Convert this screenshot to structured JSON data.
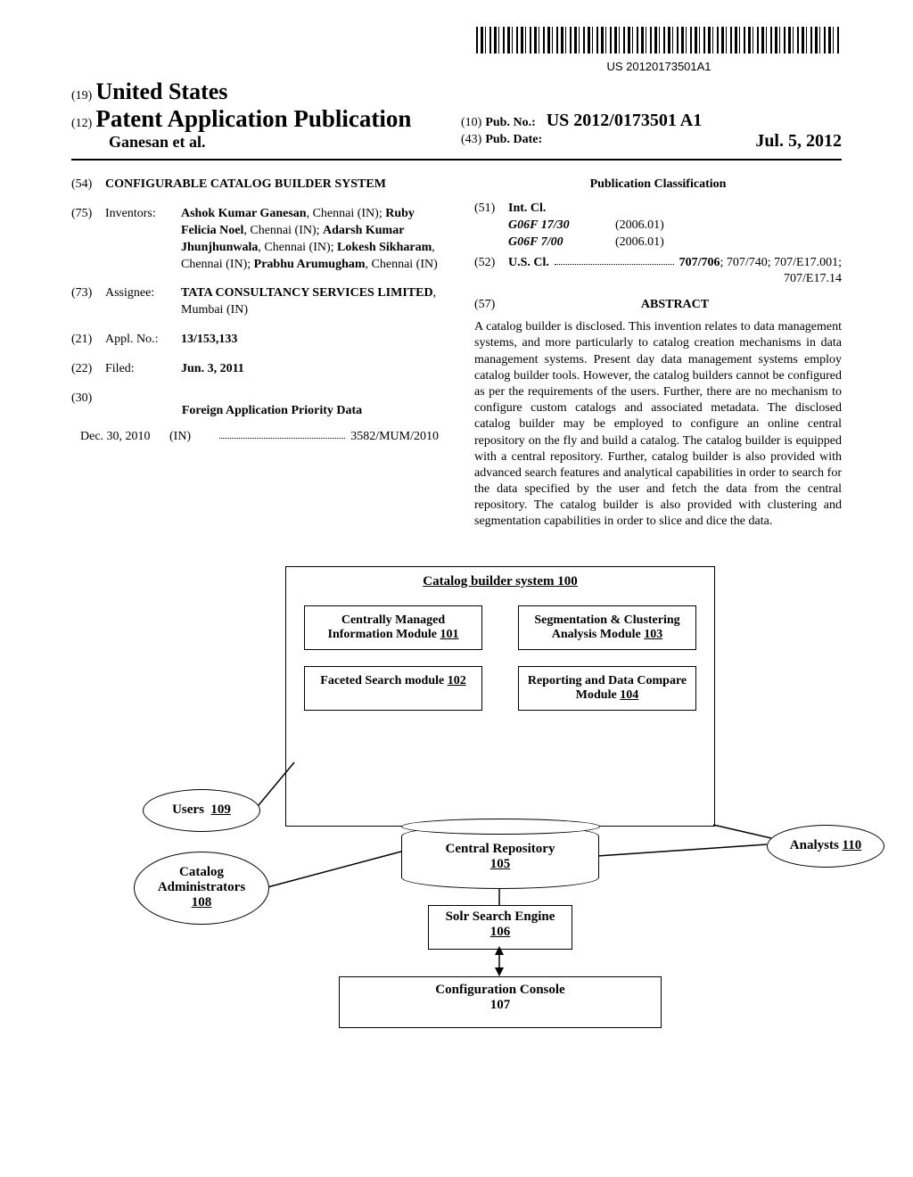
{
  "barcode_number": "US 20120173501A1",
  "header": {
    "code19": "(19)",
    "country": "United States",
    "code12": "(12)",
    "pub_type": "Patent Application Publication",
    "authors": "Ganesan et al.",
    "code10": "(10)",
    "pub_no_label": "Pub. No.:",
    "pub_no": "US 2012/0173501 A1",
    "code43": "(43)",
    "pub_date_label": "Pub. Date:",
    "pub_date": "Jul. 5, 2012"
  },
  "fields": {
    "title_code": "(54)",
    "title": "CONFIGURABLE CATALOG BUILDER SYSTEM",
    "inventors_code": "(75)",
    "inventors_label": "Inventors:",
    "inventors_value": "Ashok Kumar Ganesan, Chennai (IN); Ruby Felicia Noel, Chennai (IN); Adarsh Kumar Jhunjhunwala, Chennai (IN); Lokesh Sikharam, Chennai (IN); Prabhu Arumugham, Chennai (IN)",
    "assignee_code": "(73)",
    "assignee_label": "Assignee:",
    "assignee_value": "TATA CONSULTANCY SERVICES LIMITED, Mumbai (IN)",
    "appl_code": "(21)",
    "appl_label": "Appl. No.:",
    "appl_value": "13/153,133",
    "filed_code": "(22)",
    "filed_label": "Filed:",
    "filed_value": "Jun. 3, 2011",
    "foreign_code": "(30)",
    "foreign_head": "Foreign Application Priority Data",
    "foreign_date": "Dec. 30, 2010",
    "foreign_cc": "(IN)",
    "foreign_num": "3582/MUM/2010"
  },
  "classification": {
    "pub_class_head": "Publication Classification",
    "intcl_code": "(51)",
    "intcl_label": "Int. Cl.",
    "intcl_1_name": "G06F 17/30",
    "intcl_1_ver": "(2006.01)",
    "intcl_2_name": "G06F 7/00",
    "intcl_2_ver": "(2006.01)",
    "uscl_code": "(52)",
    "uscl_label": "U.S. Cl.",
    "uscl_value": "707/706; 707/740; 707/E17.001; 707/E17.14"
  },
  "abstract": {
    "code": "(57)",
    "head": "ABSTRACT",
    "body": "A catalog builder is disclosed. This invention relates to data management systems, and more particularly to catalog creation mechanisms in data management systems. Present day data management systems employ catalog builder tools. However, the catalog builders cannot be configured as per the requirements of the users. Further, there are no mechanism to configure custom catalogs and associated metadata. The disclosed catalog builder may be employed to configure an online central repository on the fly and build a catalog. The catalog builder is equipped with a central repository. Further, catalog builder is also provided with advanced search features and analytical capabilities in order to search for the data specified by the user and fetch the data from the central repository. The catalog builder is also provided with clustering and segmentation capabilities in order to slice and dice the data."
  },
  "figure": {
    "system_title": "Catalog builder system",
    "system_ref": "100",
    "mod1": "Centrally Managed Information Module",
    "mod1_ref": "101",
    "mod2": "Faceted Search module",
    "mod2_ref": "102",
    "mod3": "Segmentation & Clustering Analysis Module",
    "mod3_ref": "103",
    "mod4": "Reporting and Data Compare Module",
    "mod4_ref": "104",
    "repo": "Central Repository",
    "repo_ref": "105",
    "solr": "Solr Search Engine",
    "solr_ref": "106",
    "config": "Configuration Console",
    "config_ref": "107",
    "admins": "Catalog Administrators",
    "admins_ref": "108",
    "users": "Users",
    "users_ref": "109",
    "analysts": "Analysts",
    "analysts_ref": "110"
  }
}
